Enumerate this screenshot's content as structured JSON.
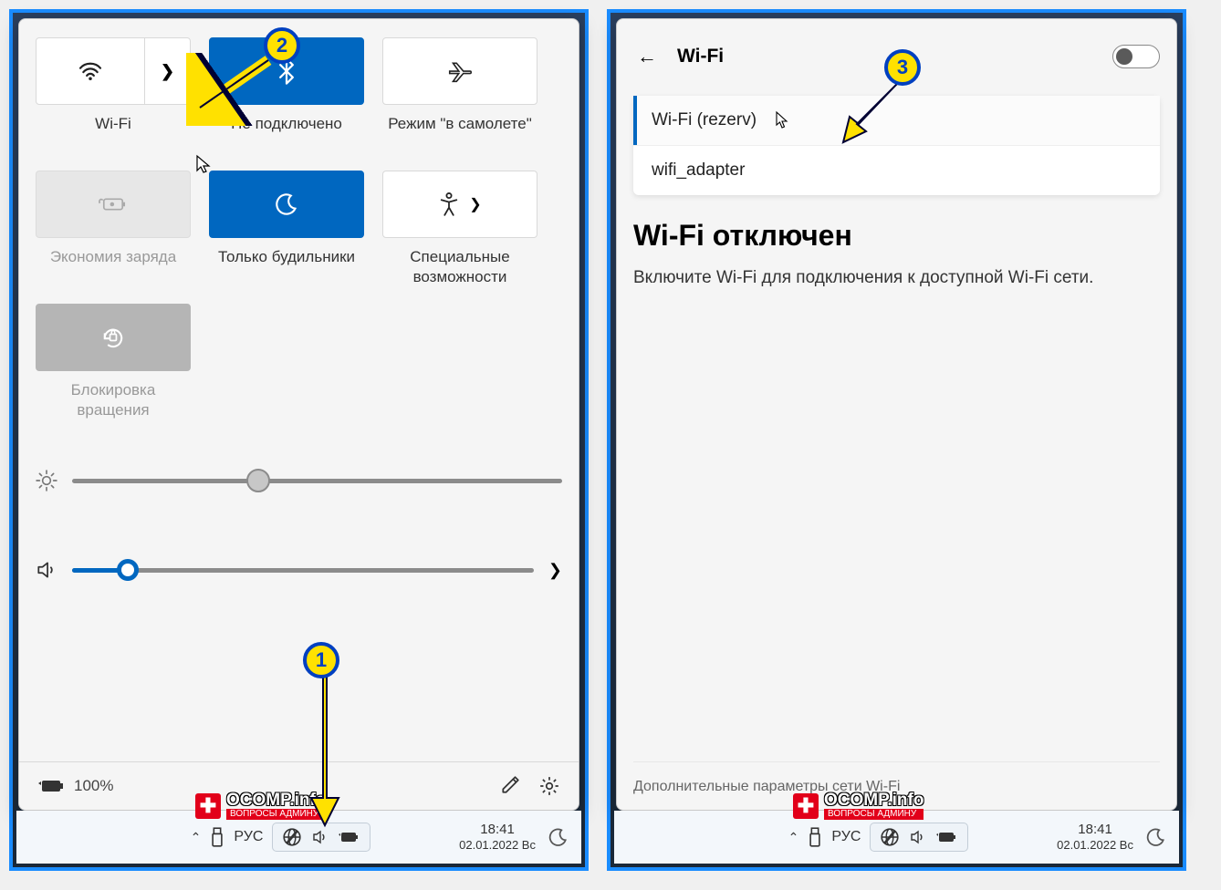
{
  "markers": {
    "one": "1",
    "two": "2",
    "three": "3"
  },
  "quick": {
    "wifi_label": "Wi-Fi",
    "bluetooth_label": "Не подключено",
    "airplane_label": "Режим \"в самолете\"",
    "battery_saver_label": "Экономия заряда",
    "alarms_only_label": "Только будильники",
    "accessibility_label": "Специальные возможности",
    "rotation_lock_label": "Блокировка вращения",
    "battery_percent": "100%"
  },
  "wifi": {
    "title": "Wi-Fi",
    "networks": [
      {
        "name": "Wi-Fi (rezerv)"
      },
      {
        "name": "wifi_adapter"
      }
    ],
    "off_heading": "Wi-Fi отключен",
    "off_text": "Включите Wi-Fi для подключения к доступной Wi-Fi сети.",
    "more_settings": "Дополнительные параметры сети Wi-Fi"
  },
  "taskbar": {
    "lang": "РУС",
    "time": "18:41",
    "date": "02.01.2022 Вс"
  },
  "watermark": {
    "brand": "OCOMP.info",
    "sub": "ВОПРОСЫ АДМИНУ"
  }
}
